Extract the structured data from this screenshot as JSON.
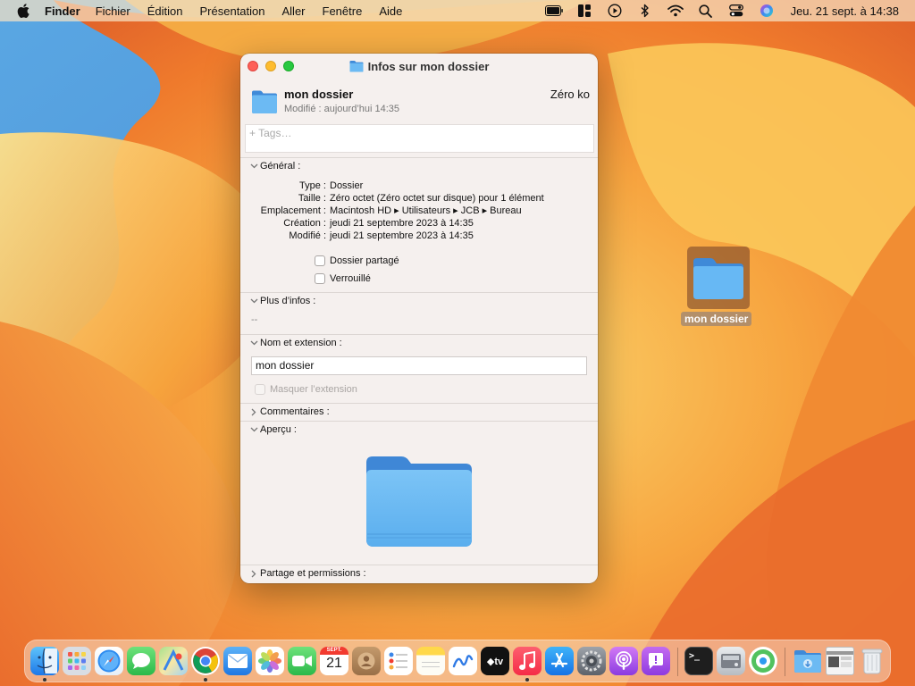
{
  "menubar": {
    "app_name": "Finder",
    "menus": [
      "Fichier",
      "Édition",
      "Présentation",
      "Aller",
      "Fenêtre",
      "Aide"
    ],
    "clock": "Jeu. 21 sept. à 14:38"
  },
  "window": {
    "title": "Infos sur mon dossier",
    "item_name": "mon dossier",
    "modified_line": "Modifié : aujourd’hui 14:35",
    "size": "Zéro ko",
    "tags_placeholder": "+ Tags…",
    "general": {
      "header": "Général :",
      "rows": [
        {
          "key": "Type :",
          "value": "Dossier"
        },
        {
          "key": "Taille :",
          "value": "Zéro octet (Zéro octet sur disque) pour 1 élément"
        },
        {
          "key": "Emplacement :",
          "value": "Macintosh HD ▸ Utilisateurs ▸ JCB ▸ Bureau"
        },
        {
          "key": "Création :",
          "value": "jeudi 21 septembre 2023 à 14:35"
        },
        {
          "key": "Modifié :",
          "value": "jeudi 21 septembre 2023 à 14:35"
        }
      ],
      "shared_folder_label": "Dossier partagé",
      "locked_label": "Verrouillé"
    },
    "more_info": {
      "header": "Plus d’infos :",
      "value": "--"
    },
    "name_extension": {
      "header": "Nom et extension :",
      "name_value": "mon dossier",
      "hide_extension_label": "Masquer l’extension"
    },
    "comments_header": "Commentaires :",
    "preview_header": "Aperçu :",
    "sharing_header": "Partage et permissions :"
  },
  "desktop": {
    "folder_label": "mon dossier"
  },
  "dock": {
    "calendar_month": "SEPT.",
    "calendar_day": "21"
  },
  "colors": {
    "folder_blue": "#5aaeee",
    "folder_tab": "#4a90d9",
    "accent": "#2f7ae5"
  }
}
